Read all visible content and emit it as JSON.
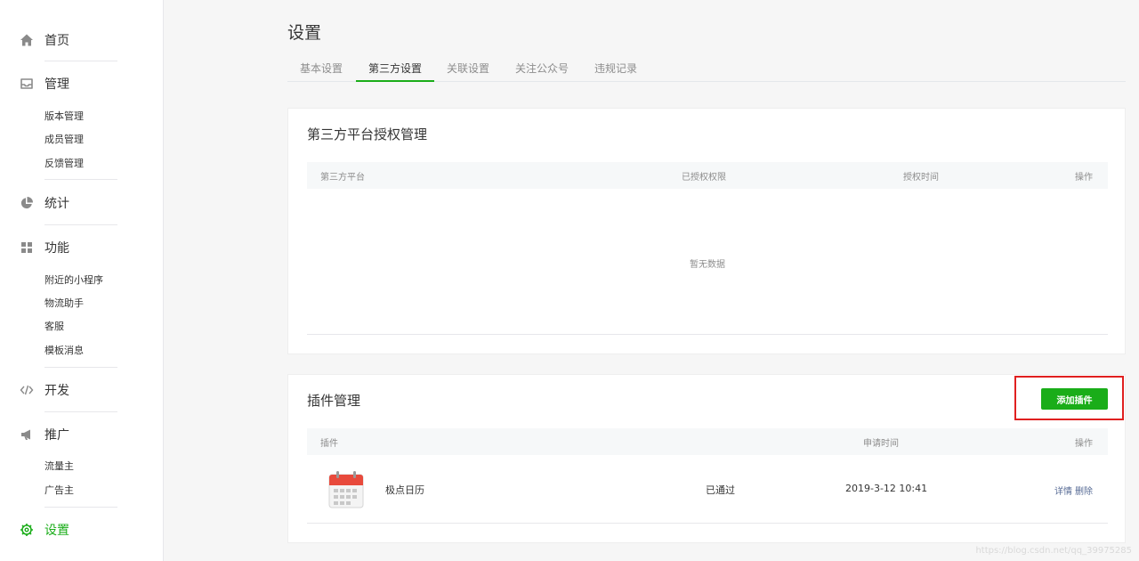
{
  "sidebar": {
    "home": {
      "label": "首页",
      "icon": "home-icon"
    },
    "manage": {
      "label": "管理",
      "icon": "inbox-icon",
      "items": [
        "版本管理",
        "成员管理",
        "反馈管理"
      ]
    },
    "stats": {
      "label": "统计",
      "icon": "pie-chart-icon"
    },
    "features": {
      "label": "功能",
      "icon": "grid-icon",
      "items": [
        "附近的小程序",
        "物流助手",
        "客服",
        "模板消息"
      ]
    },
    "dev": {
      "label": "开发",
      "icon": "code-icon"
    },
    "promote": {
      "label": "推广",
      "icon": "megaphone-icon",
      "items": [
        "流量主",
        "广告主"
      ]
    },
    "settings": {
      "label": "设置",
      "icon": "gear-icon",
      "active": true
    }
  },
  "header": {
    "title": "设置",
    "tabs": [
      {
        "label": "基本设置",
        "active": false
      },
      {
        "label": "第三方设置",
        "active": true
      },
      {
        "label": "关联设置",
        "active": false
      },
      {
        "label": "关注公众号",
        "active": false
      },
      {
        "label": "违规记录",
        "active": false
      }
    ]
  },
  "third_party": {
    "title": "第三方平台授权管理",
    "columns": [
      "第三方平台",
      "已授权权限",
      "授权时间",
      "操作"
    ],
    "empty_text": "暂无数据"
  },
  "plugins": {
    "title": "插件管理",
    "add_button": "添加插件",
    "columns": [
      "插件",
      "申请时间",
      "操作"
    ],
    "rows": [
      {
        "name": "极点日历",
        "status": "已通过",
        "applied_at": "2019-3-12 10:41",
        "action_detail": "详情",
        "action_delete": "删除",
        "icon": "calendar-icon"
      }
    ]
  },
  "colors": {
    "accent": "#1aad19",
    "highlight": "#e02020",
    "link": "#576b95"
  },
  "watermark": "https://blog.csdn.net/qq_39975285"
}
